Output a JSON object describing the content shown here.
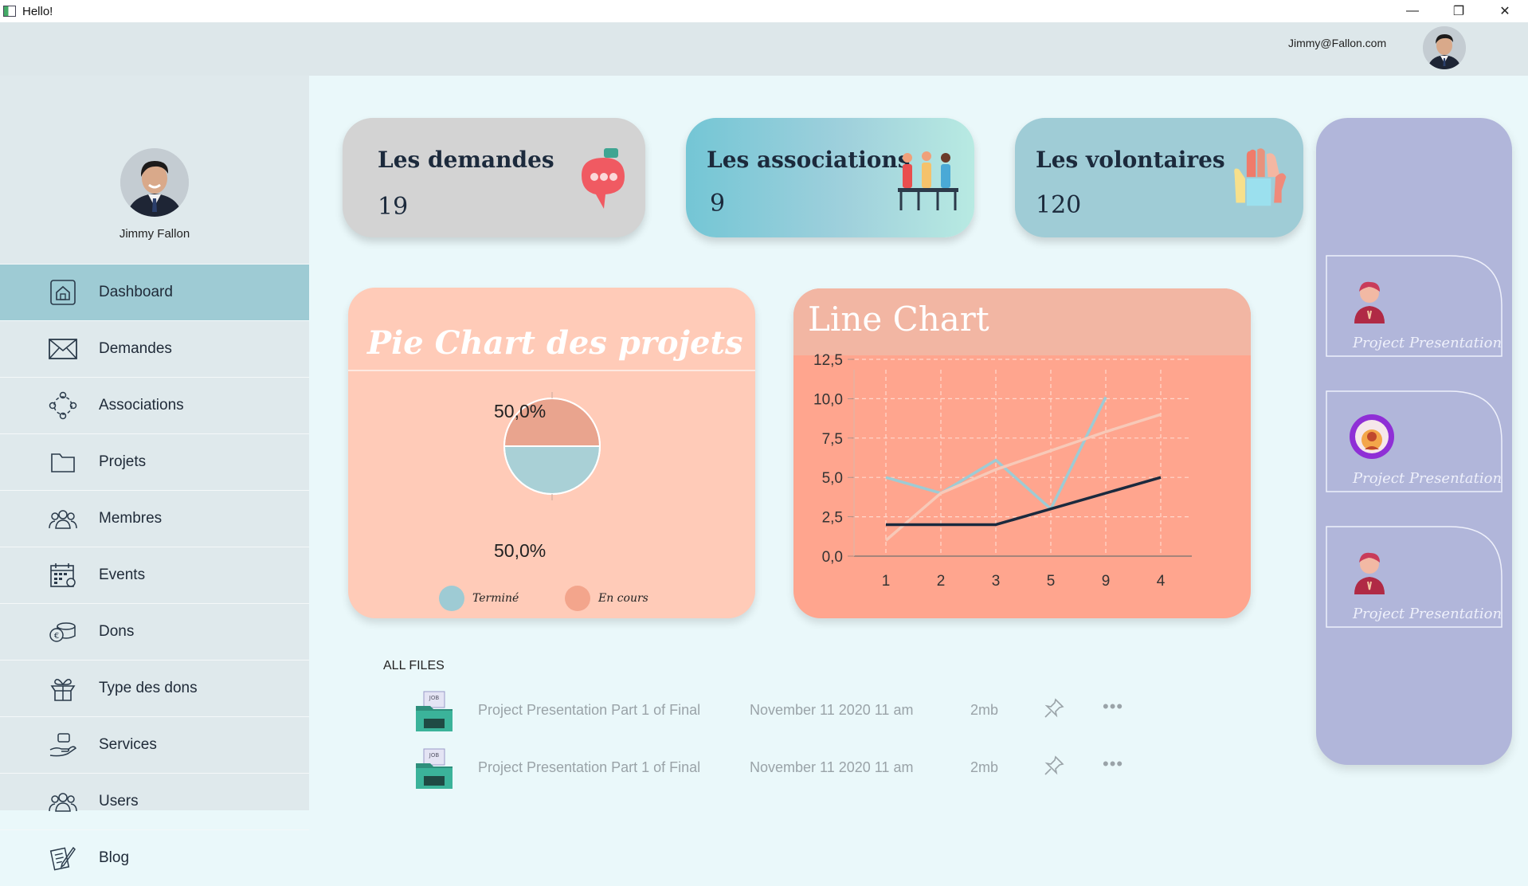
{
  "window": {
    "title": "Hello!",
    "controls": {
      "minimize": "—",
      "maximize": "❐",
      "close": "✕"
    }
  },
  "header": {
    "user_email": "Jimmy@Fallon.com"
  },
  "profile": {
    "name": "Jimmy Fallon"
  },
  "sidebar": {
    "items": [
      {
        "label": "Dashboard",
        "icon": "home-icon"
      },
      {
        "label": "Demandes",
        "icon": "envelope-icon"
      },
      {
        "label": "Associations",
        "icon": "network-icon"
      },
      {
        "label": "Projets",
        "icon": "folder-icon"
      },
      {
        "label": "Membres",
        "icon": "group-icon"
      },
      {
        "label": "Events",
        "icon": "calendar-icon"
      },
      {
        "label": "Dons",
        "icon": "coins-icon"
      },
      {
        "label": "Type des dons",
        "icon": "gift-box-icon"
      },
      {
        "label": "Services",
        "icon": "service-hand-icon"
      },
      {
        "label": "Users",
        "icon": "users-icon"
      },
      {
        "label": "Blog",
        "icon": "blog-icon"
      }
    ],
    "active": "Dashboard"
  },
  "stats": [
    {
      "title": "Les demandes",
      "value": "19",
      "icon": "chat-bubble-icon",
      "color": "#d3d3d3"
    },
    {
      "title": "Les associations",
      "value": "9",
      "icon": "people-meeting-icon",
      "color": "#7ccbd8"
    },
    {
      "title": "Les volontaires",
      "value": "120",
      "icon": "raised-hands-icon",
      "color": "#9fccd6"
    }
  ],
  "pie_panel": {
    "title": "Pie Chart des projets",
    "labels": {
      "top": "50,0%",
      "bottom": "50,0%"
    },
    "legend": [
      {
        "label": "Terminé",
        "color": "#9ecbd4"
      },
      {
        "label": "En cours",
        "color": "#f3a58c"
      }
    ]
  },
  "line_panel": {
    "title": "Line Chart"
  },
  "chart_data": [
    {
      "type": "pie",
      "title": "Pie Chart des projets",
      "slices": [
        {
          "label": "En cours",
          "value": 50.0,
          "color": "#e9a48e"
        },
        {
          "label": "Terminé",
          "value": 50.0,
          "color": "#a9d0d6"
        }
      ],
      "legend": "bottom"
    },
    {
      "type": "line",
      "title": "Line Chart",
      "categories": [
        "1",
        "2",
        "3",
        "5",
        "9",
        "4"
      ],
      "series": [
        {
          "values": [
            5.0,
            4.0,
            6.1,
            3.0,
            10.1,
            null
          ],
          "color": "#9ecbd4"
        },
        {
          "values": [
            1.0,
            4.0,
            5.5,
            6.7,
            7.9,
            9.0
          ],
          "color": "#f7c9b8"
        },
        {
          "values": [
            2.0,
            2.0,
            2.0,
            3.0,
            4.0,
            5.0
          ],
          "color": "#1b2a3e"
        }
      ],
      "yticks": [
        "0,0",
        "2,5",
        "5,0",
        "7,5",
        "10,0",
        "12,5"
      ],
      "ylim": [
        0,
        12.5
      ],
      "grid": true
    }
  ],
  "files": {
    "heading": "ALL FILES",
    "rows": [
      {
        "name": "Project Presentation Part 1 of Final",
        "date": "November 11 2020 11 am",
        "size": "2mb",
        "more": "•••"
      },
      {
        "name": "Project Presentation Part 1 of Final",
        "date": "November 11 2020 11 am",
        "size": "2mb",
        "more": "•••"
      }
    ]
  },
  "right_panel": {
    "cards": [
      {
        "label": "Project Presentation",
        "icon": "person-avatar-icon"
      },
      {
        "label": "Project Presentation",
        "icon": "circle-avatar-icon"
      },
      {
        "label": "Project Presentation",
        "icon": "person-avatar-icon"
      }
    ]
  }
}
